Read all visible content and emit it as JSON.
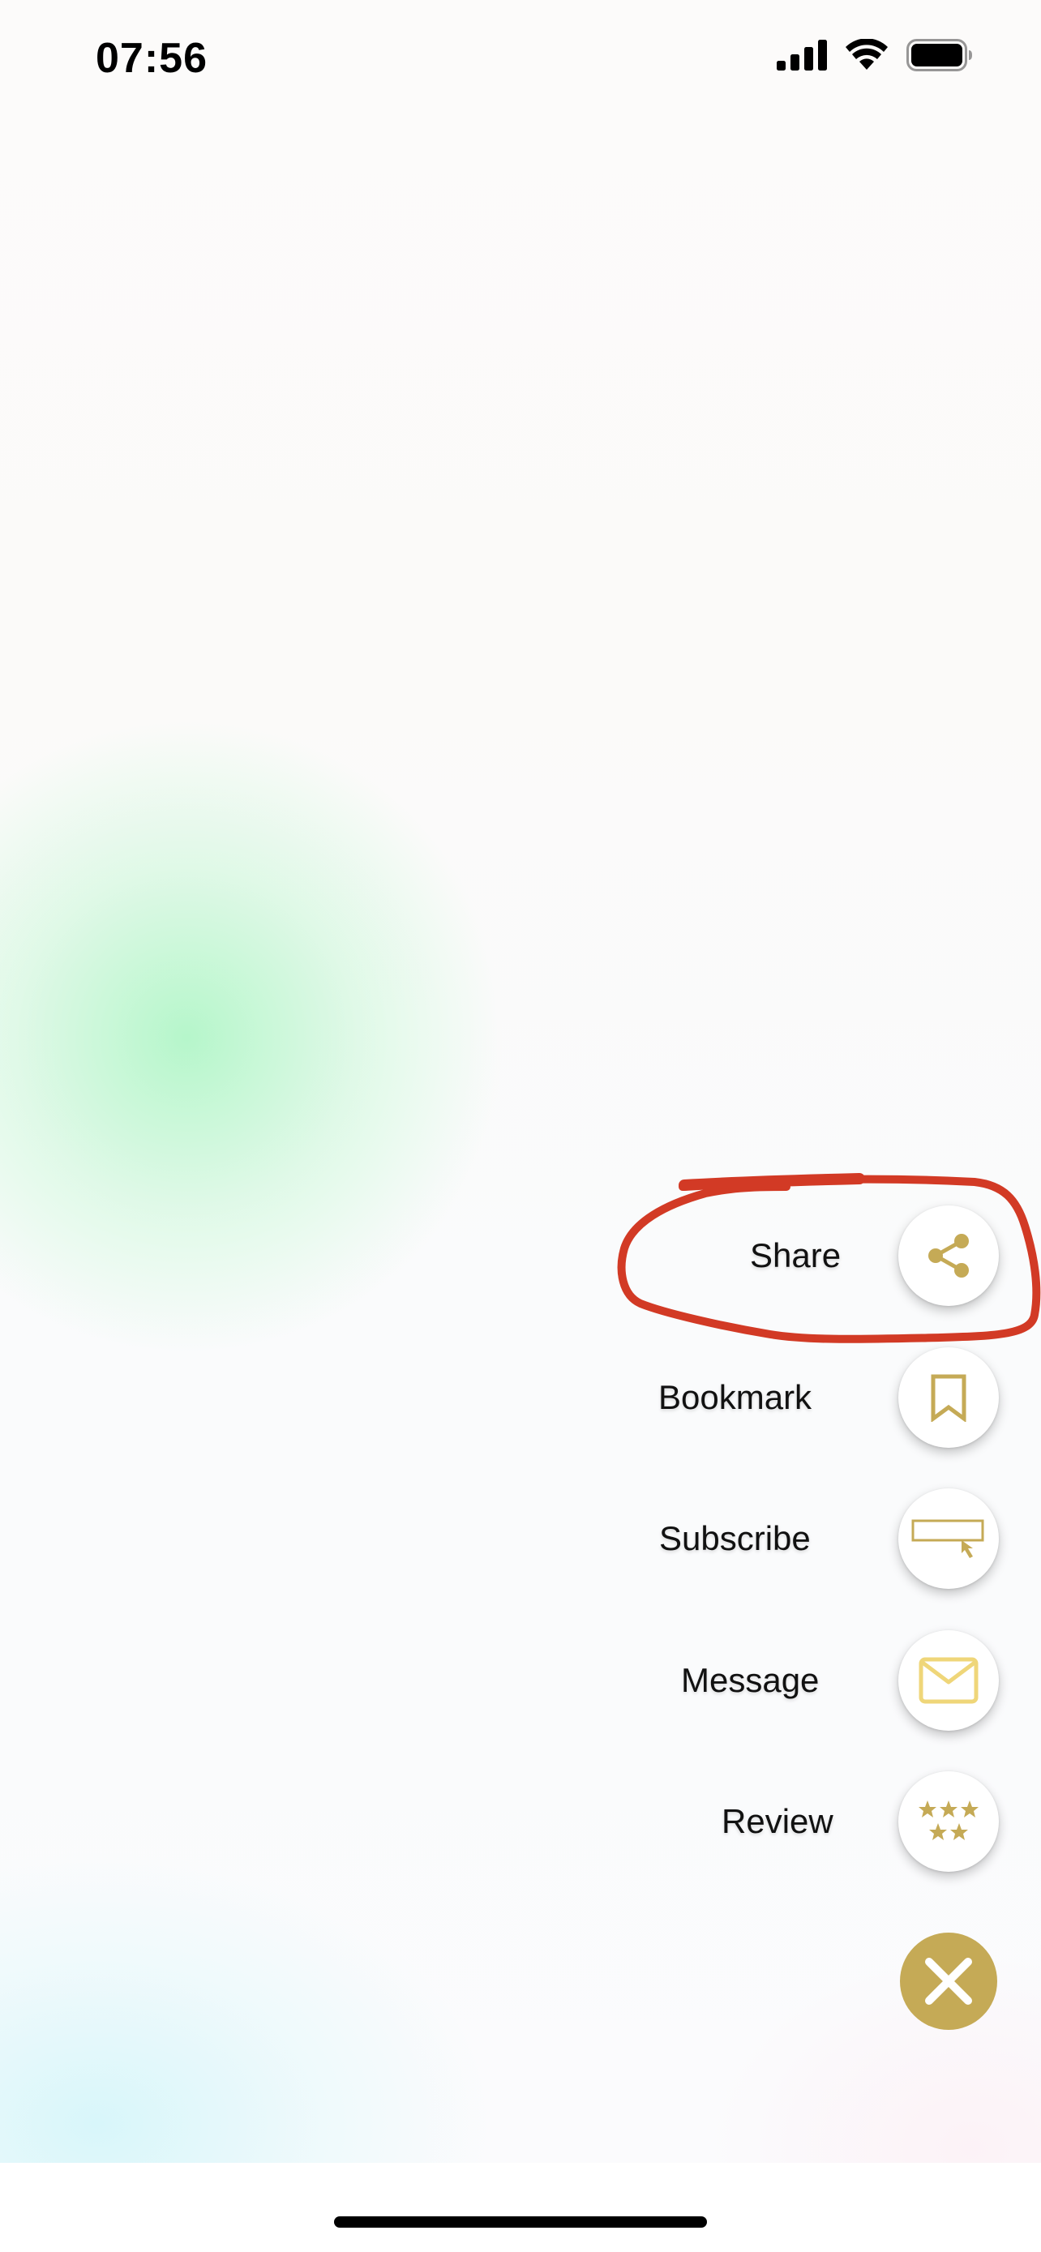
{
  "status_bar": {
    "time": "07:56"
  },
  "menu": {
    "items": [
      {
        "label": "Share",
        "icon": "share-icon"
      },
      {
        "label": "Bookmark",
        "icon": "bookmark-icon"
      },
      {
        "label": "Subscribe",
        "icon": "subscribe-icon"
      },
      {
        "label": "Message",
        "icon": "mail-icon"
      },
      {
        "label": "Review",
        "icon": "stars-icon"
      }
    ],
    "close_icon": "close-icon"
  },
  "colors": {
    "accent_gold": "#c5aa56",
    "mail_yellow": "#efd679",
    "annotation_red": "#d23a25"
  }
}
